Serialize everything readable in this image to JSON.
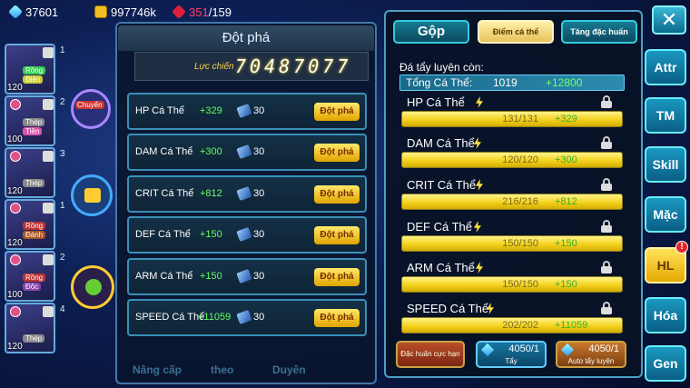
{
  "resources": {
    "gems": "37601",
    "gold": "997746k",
    "stamina_current": "351",
    "stamina_max": "/159"
  },
  "team": [
    {
      "level": "120",
      "tag": "Rồng",
      "tag2": "Điện",
      "badge": "1",
      "color": "#3c5"
    },
    {
      "level": "100",
      "tag": "Thép",
      "tag2": "Tiên",
      "badge": "2",
      "color": "#888"
    },
    {
      "level": "120",
      "tag": "Thép",
      "badge": "3",
      "color": "#888"
    },
    {
      "level": "120",
      "tag": "Rồng",
      "tag2": "Đánh",
      "badge": "1",
      "color": "#b33"
    },
    {
      "level": "100",
      "tag": "Rồng",
      "tag2": "Độc",
      "badge": "2",
      "color": "#b33"
    },
    {
      "level": "120",
      "tag": "Thép",
      "badge": "4",
      "color": "#888"
    }
  ],
  "middle": {
    "chuyen_label": "Chuyển"
  },
  "breakthrough": {
    "title": "Đột phá",
    "power_label": "Lực chiến",
    "power_value": "70487077",
    "rows": [
      {
        "name": "HP Cá Thể",
        "bonus": "+329",
        "cost": "30",
        "button": "Đột phá"
      },
      {
        "name": "DAM Cá Thể",
        "bonus": "+300",
        "cost": "30",
        "button": "Đột phá"
      },
      {
        "name": "CRIT Cá Thể",
        "bonus": "+812",
        "cost": "30",
        "button": "Đột phá"
      },
      {
        "name": "DEF Cá Thể",
        "bonus": "+150",
        "cost": "30",
        "button": "Đột phá"
      },
      {
        "name": "ARM Cá Thể",
        "bonus": "+150",
        "cost": "30",
        "button": "Đột phá"
      },
      {
        "name": "SPEED Cá Thể",
        "bonus": "+11059",
        "cost": "30",
        "button": "Đột phá"
      }
    ],
    "bottom_labels": [
      "Nâng cấp",
      "theo",
      "Duyên"
    ]
  },
  "training": {
    "tabs": [
      "Gộp",
      "Điểm cá thể",
      "Tăng đặc huấn"
    ],
    "remaining_label": "Đá tẩy luyện còn:",
    "total_label": "Tổng Cá Thể:",
    "total_value": "1019",
    "total_bonus": "+12800",
    "stats": [
      {
        "name": "HP Cá Thể",
        "current": "131/131",
        "bonus": "+329"
      },
      {
        "name": "DAM Cá Thể",
        "current": "120/120",
        "bonus": "+300"
      },
      {
        "name": "CRIT Cá Thể",
        "current": "216/216",
        "bonus": "+812"
      },
      {
        "name": "DEF Cá Thể",
        "current": "150/150",
        "bonus": "+150"
      },
      {
        "name": "ARM Cá Thể",
        "current": "150/150",
        "bonus": "+150"
      },
      {
        "name": "SPEED Cá Thể",
        "current": "202/202",
        "bonus": "+11059"
      }
    ],
    "buttons": {
      "special": "Đặc huấn cực hạn",
      "wash_count": "4050/1",
      "wash_label": "Tẩy",
      "auto_count": "4050/1",
      "auto_label": "Auto tẩy luyện"
    }
  },
  "side_tabs": [
    "Attr",
    "TM",
    "Skill",
    "Mặc",
    "HL",
    "Hóa",
    "Gen"
  ],
  "side_badge": "!",
  "close_label": "✕"
}
